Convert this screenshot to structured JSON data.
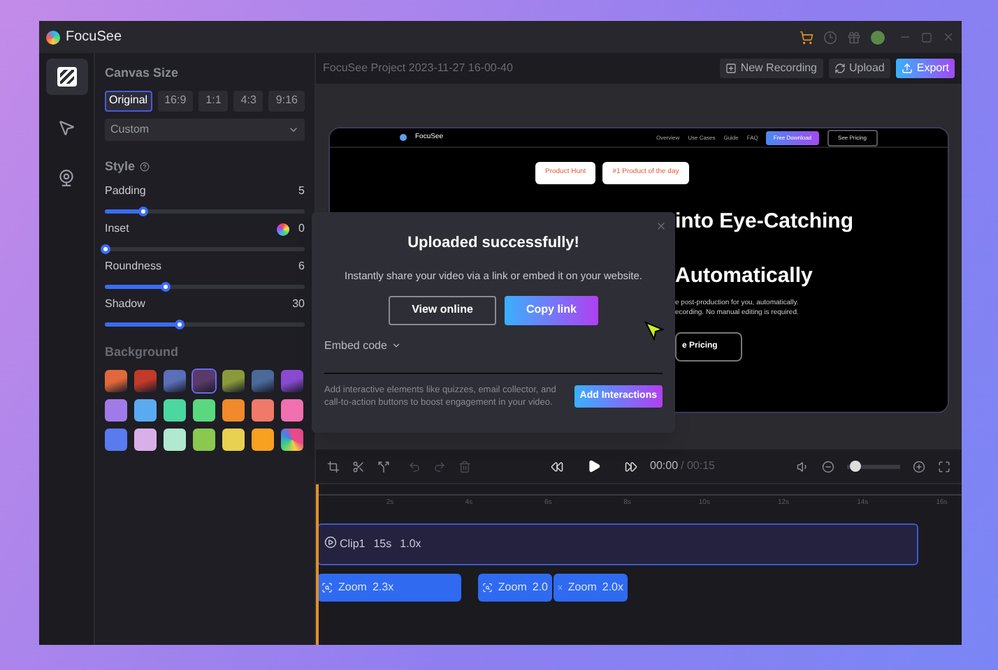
{
  "window": {
    "title": "FocuSee"
  },
  "project_title": "FocuSee Project 2023-11-27 16-00-40",
  "header_buttons": [
    {
      "label": "New Recording",
      "kind": "plain"
    },
    {
      "label": "Upload",
      "kind": "plain"
    },
    {
      "label": "Export",
      "kind": "primary"
    }
  ],
  "rail": [
    {
      "selected": true,
      "kind": "canvas"
    },
    {
      "selected": false,
      "kind": "cursor"
    },
    {
      "selected": false,
      "kind": "camera"
    }
  ],
  "canvas_size": {
    "title": "Canvas Size",
    "options": [
      {
        "label": "Original",
        "selected": true
      },
      {
        "label": "16:9",
        "selected": false
      },
      {
        "label": "1:1",
        "selected": false
      },
      {
        "label": "4:3",
        "selected": false
      },
      {
        "label": "9:16",
        "selected": false
      }
    ],
    "dropdown": "Custom"
  },
  "style": {
    "title": "Style",
    "sliders": [
      {
        "name": "Padding",
        "reading": "5",
        "level": 0.19,
        "color_picker": false
      },
      {
        "name": "Inset",
        "reading": "0",
        "level": 0,
        "color_picker": true
      },
      {
        "name": "Roundness",
        "reading": "6",
        "level": 0.3,
        "color_picker": false
      },
      {
        "name": "Shadow",
        "reading": "30",
        "level": 0.37,
        "color_picker": false
      }
    ]
  },
  "background": {
    "title": "Background",
    "swatches": [
      {
        "kind": "image",
        "color": "#e0683a",
        "selected": false
      },
      {
        "kind": "image",
        "color": "#c23a2a",
        "selected": false
      },
      {
        "kind": "image",
        "color": "#5a6fb8",
        "selected": false
      },
      {
        "kind": "image",
        "color": "#5a3a6a",
        "selected": true
      },
      {
        "kind": "image",
        "color": "#8a9a3a",
        "selected": false
      },
      {
        "kind": "image",
        "color": "#4a6a9a",
        "selected": false
      },
      {
        "kind": "image",
        "color": "#8a4ad0",
        "selected": false
      },
      {
        "kind": "solid",
        "color": "#a07ae8",
        "selected": false
      },
      {
        "kind": "solid",
        "color": "#5aaaf0",
        "selected": false
      },
      {
        "kind": "solid",
        "color": "#4ad8a0",
        "selected": false
      },
      {
        "kind": "solid",
        "color": "#5ad880",
        "selected": false
      },
      {
        "kind": "solid",
        "color": "#f08a2a",
        "selected": false
      },
      {
        "kind": "solid",
        "color": "#f07a6a",
        "selected": false
      },
      {
        "kind": "solid",
        "color": "#f070b0",
        "selected": false
      },
      {
        "kind": "solid",
        "color": "#5a7af0",
        "selected": false
      },
      {
        "kind": "solid",
        "color": "#d8b0e8",
        "selected": false
      },
      {
        "kind": "solid",
        "color": "#b0e8d0",
        "selected": false
      },
      {
        "kind": "solid",
        "color": "#8ac850",
        "selected": false
      },
      {
        "kind": "solid",
        "color": "#e8d050",
        "selected": false
      },
      {
        "kind": "solid",
        "color": "#f8a020",
        "selected": false
      },
      {
        "kind": "rainbow",
        "color": "#e84a8a",
        "selected": false
      }
    ]
  },
  "preview_site": {
    "brand": "FocuSee",
    "nav": [
      "Overview",
      "Use Cases",
      "Guide",
      "FAQ"
    ],
    "cta": "Free Download",
    "secondary": "See Pricing",
    "badges": [
      "Product Hunt",
      "#1 Product of the day"
    ],
    "headline": [
      "into Eye-Catching",
      "Automatically"
    ],
    "body": [
      "e post-production for you, automatically.",
      "ecording. No manual editing is required."
    ],
    "button": "e Pricing"
  },
  "dialog": {
    "title": "Uploaded successfully!",
    "message": "Instantly share your video via a link or embed it on your website.",
    "buttons": [
      {
        "label": "View online",
        "kind": "outline"
      },
      {
        "label": "Copy link",
        "kind": "primary"
      }
    ],
    "embed": "Embed code",
    "promo": "Add interactive elements like quizzes, email collector, and call-to-action buttons to boost engagement in your video.",
    "promo_button": "Add Interactions"
  },
  "player": {
    "time": "00:00",
    "duration": "/ 00:15",
    "zoom_slider": {
      "level": 0.05
    }
  },
  "ruler": [
    "2s",
    "4s",
    "6s",
    "8s",
    "10s",
    "12s",
    "14s",
    "16s"
  ],
  "clip": {
    "name": "Clip1",
    "length": "15s",
    "speed": "1.0x"
  },
  "zooms": [
    {
      "label": "Zoom",
      "value": "2.3x",
      "kind": "long"
    },
    {
      "label": "Zoom",
      "value": "2.0",
      "kind": "short"
    },
    {
      "label": "Zoom",
      "value": "2.0x",
      "kind": "short"
    }
  ]
}
